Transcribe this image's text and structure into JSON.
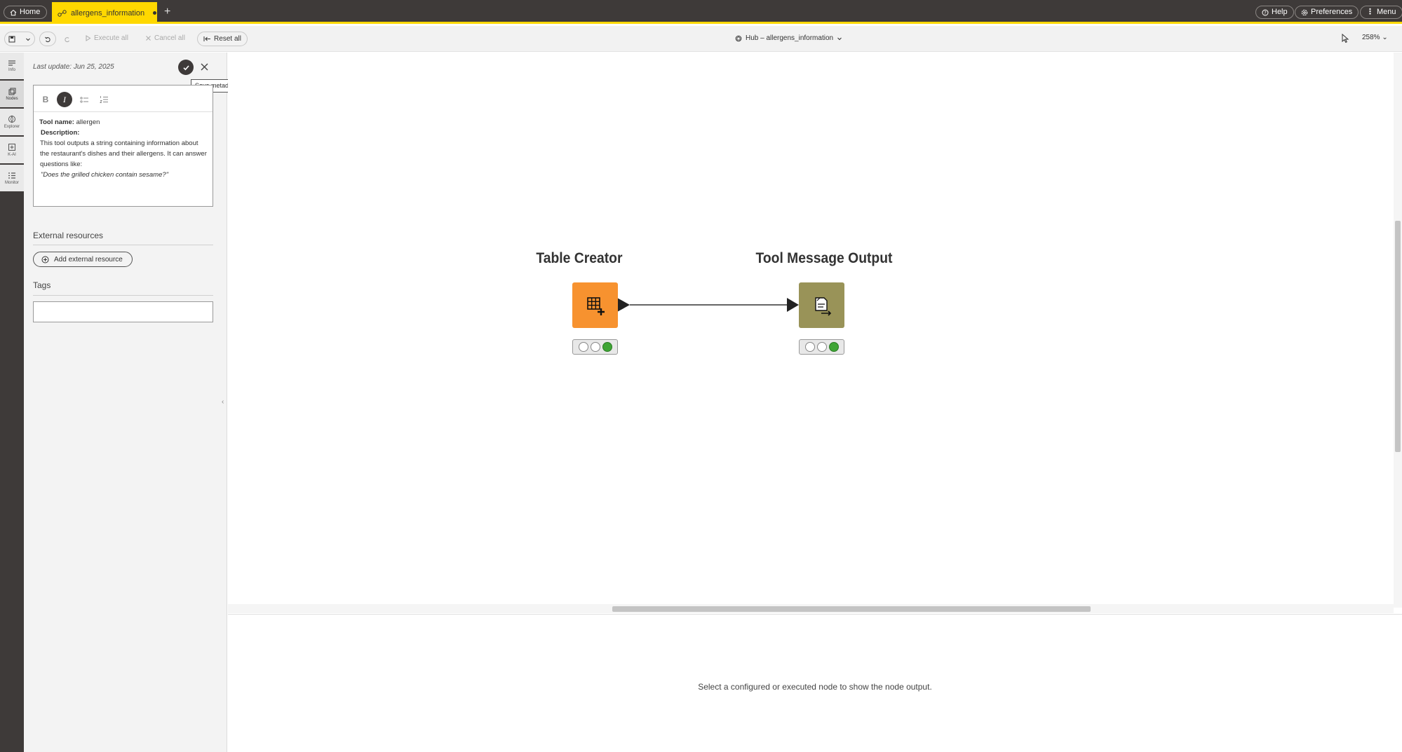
{
  "tabs": {
    "home_label": "Home",
    "active_label": "allergens_information",
    "add_symbol": "+"
  },
  "topbar_right": {
    "help_label": "Help",
    "preferences_label": "Preferences",
    "menu_label": "Menu"
  },
  "toolbar": {
    "execute_all_label": "Execute all",
    "cancel_all_label": "Cancel all",
    "reset_all_label": "Reset all",
    "hub_title": "Hub – allergens_information",
    "zoom_label": "258%"
  },
  "rail": {
    "items": [
      {
        "label": "Info",
        "icon": "info-icon"
      },
      {
        "label": "Nodes",
        "icon": "nodes-icon"
      },
      {
        "label": "Explorer",
        "icon": "explorer-icon"
      },
      {
        "label": "K-AI",
        "icon": "kai-icon"
      },
      {
        "label": "Monitor",
        "icon": "monitor-icon"
      }
    ]
  },
  "metadata": {
    "last_update": "Last update: Jun 25, 2025",
    "save_tooltip": "Save metadata",
    "editor": {
      "bold_label": "B",
      "italic_label": "I",
      "tool_name_key": "Tool name:",
      "tool_name_value": " allergen",
      "description_key": "Description:",
      "description_text": "This tool outputs a string containing information about the restaurant's dishes and their allergens. It can answer questions like:",
      "example_question": "\"Does the grilled chicken contain sesame?\""
    },
    "external_resources_title": "External resources",
    "add_external_resource_label": "Add external resource",
    "tags_title": "Tags"
  },
  "workflow": {
    "nodes": [
      {
        "title": "Table Creator",
        "color": "#f7922f",
        "status": [
          "empty",
          "empty",
          "green"
        ]
      },
      {
        "title": "Tool Message Output",
        "color": "#999358",
        "status": [
          "empty",
          "empty",
          "green"
        ]
      }
    ]
  },
  "output": {
    "message": "Select a configured or executed node to show the node output."
  },
  "colors": {
    "brand_yellow": "#ffd800",
    "dark": "#3e3a39",
    "status_green": "#3fa535"
  }
}
